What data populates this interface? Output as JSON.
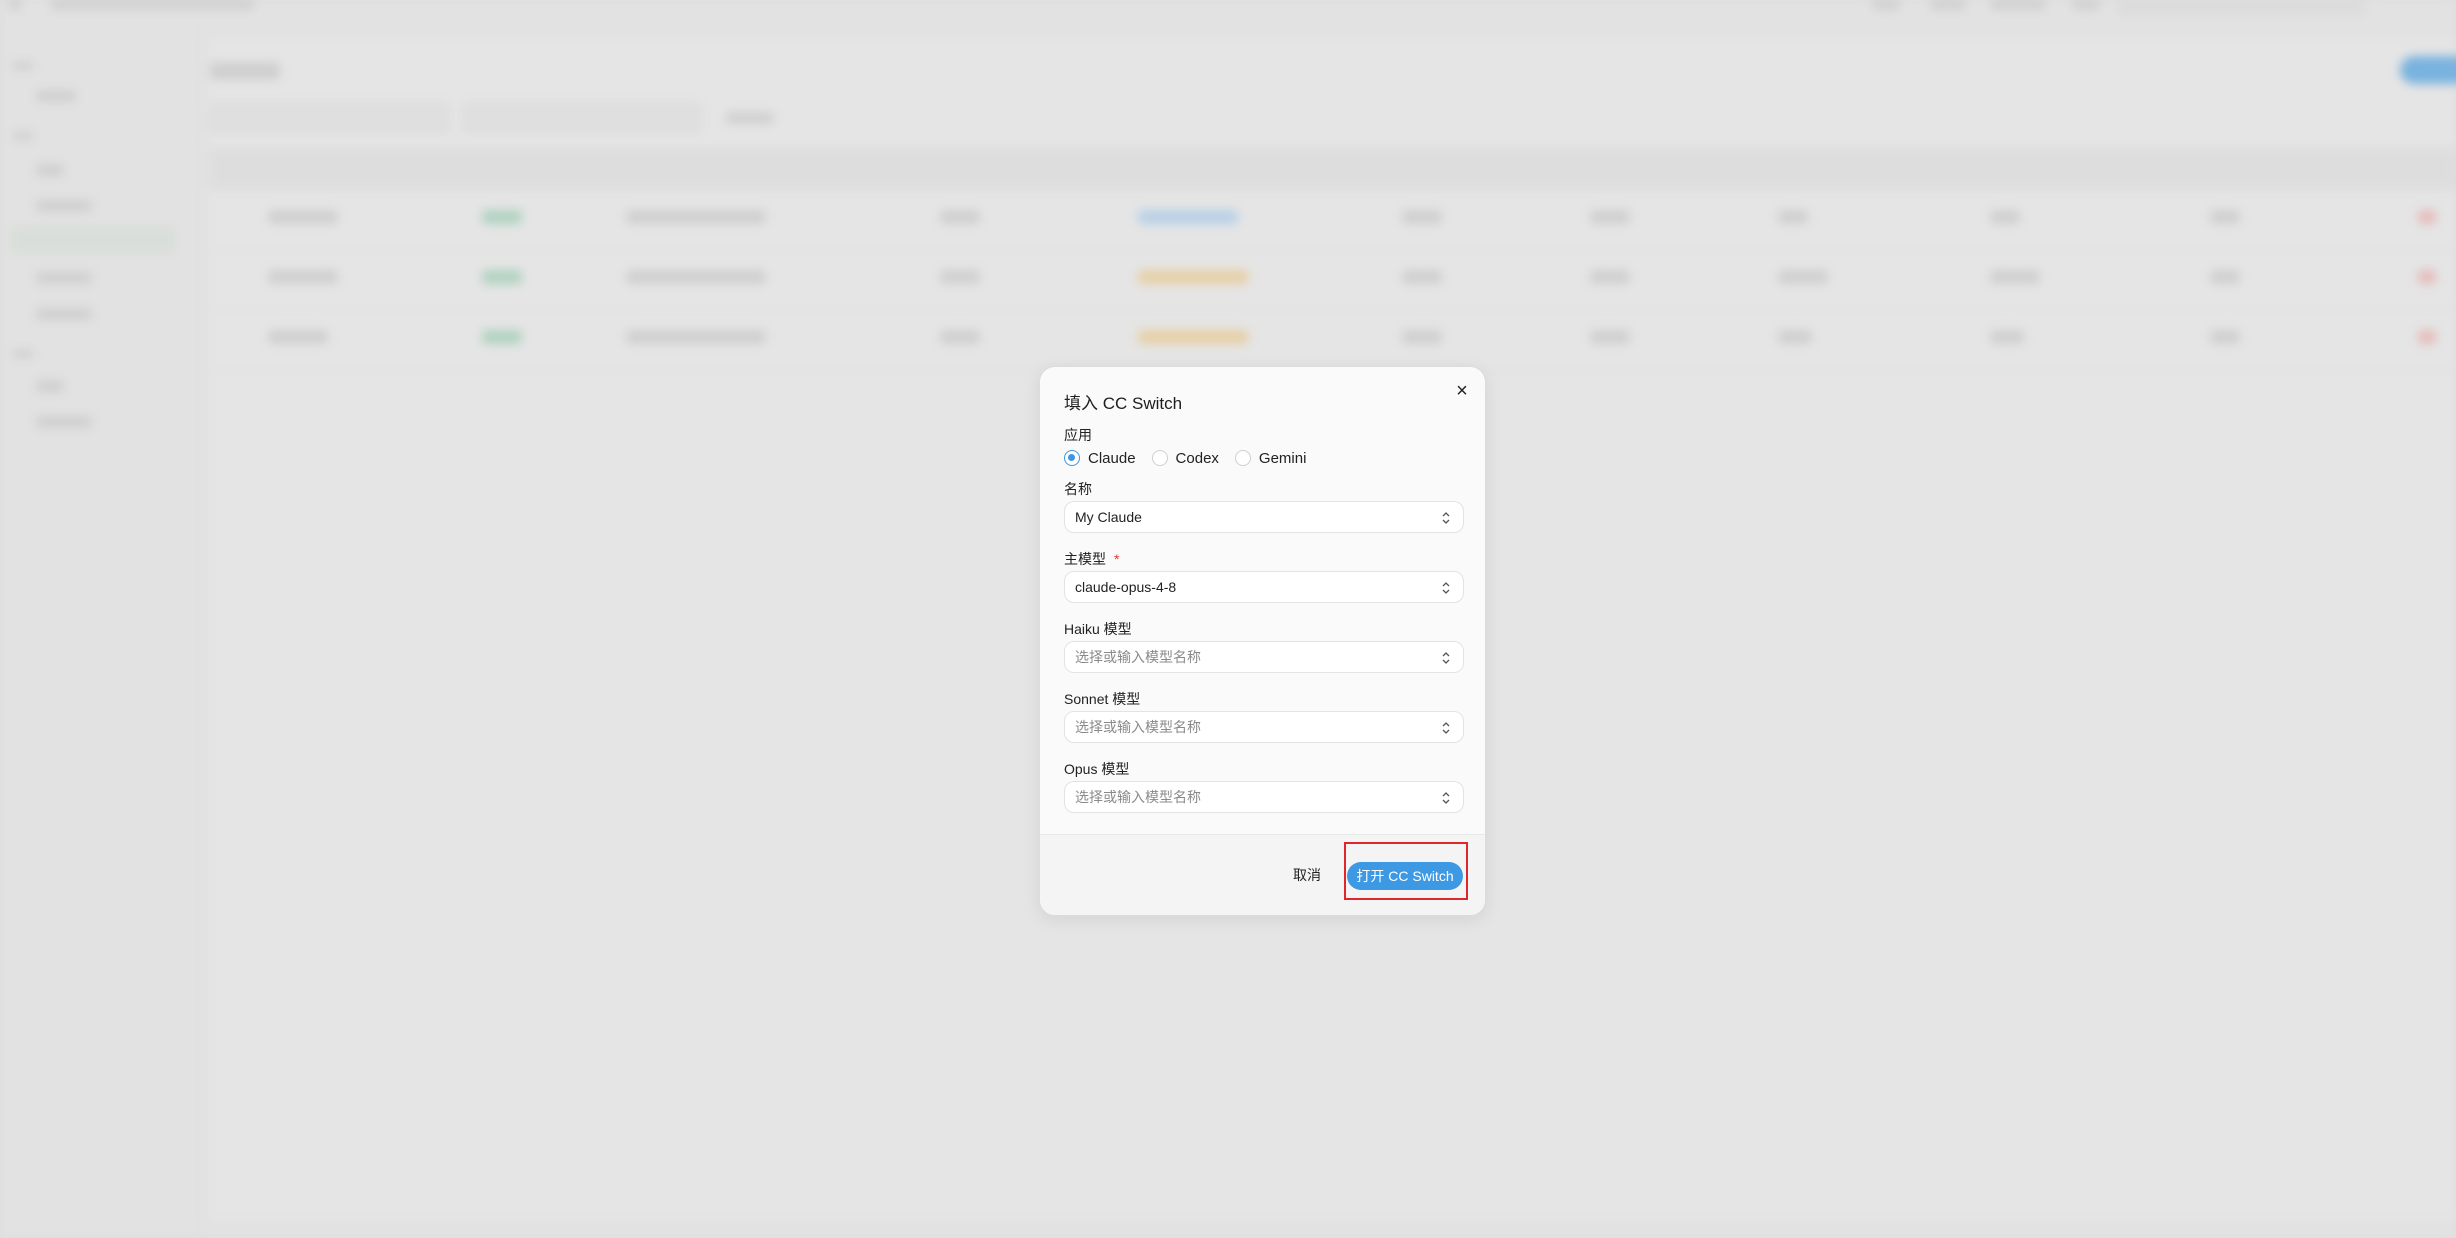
{
  "dialog": {
    "title": "填入 CC Switch",
    "app_label": "应用",
    "apps": [
      {
        "label": "Claude",
        "checked": true
      },
      {
        "label": "Codex",
        "checked": false
      },
      {
        "label": "Gemini",
        "checked": false
      }
    ],
    "name_label": "名称",
    "name_value": "My Claude",
    "main_model_label": "主模型",
    "required_mark": "*",
    "main_model_value": "claude-opus-4-8",
    "haiku_label": "Haiku 模型",
    "haiku_placeholder": "选择或输入模型名称",
    "sonnet_label": "Sonnet 模型",
    "sonnet_placeholder": "选择或输入模型名称",
    "opus_label": "Opus 模型",
    "opus_placeholder": "选择或输入模型名称",
    "cancel_label": "取消",
    "submit_label": "打开 CC Switch",
    "close_glyph": "×"
  },
  "colors": {
    "accent": "#3d99e4",
    "highlight": "#e0262d"
  },
  "icons": {
    "close": "close-icon",
    "combo": "chevron-up-down-icon"
  }
}
